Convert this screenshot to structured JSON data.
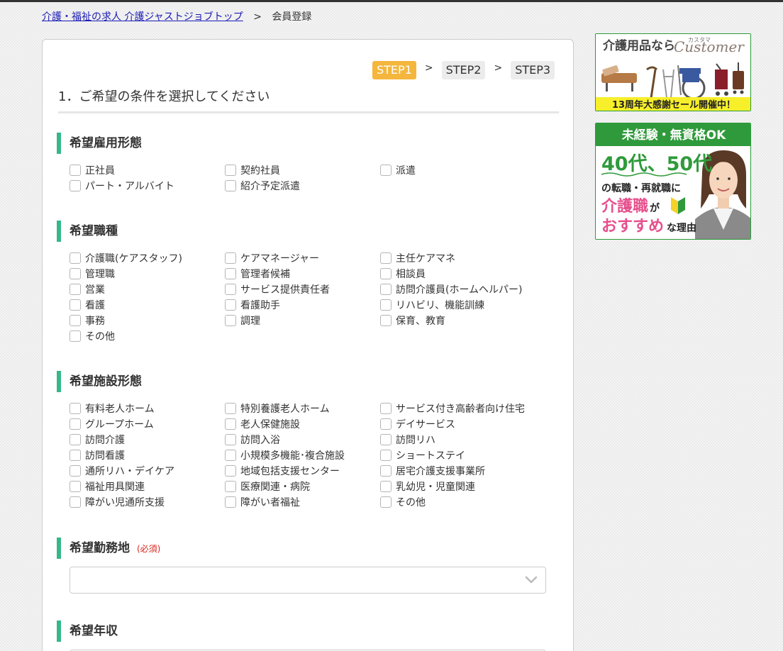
{
  "breadcrumb": {
    "home": "介護・福祉の求人 介護ジャストジョブトップ",
    "separator": ">",
    "current": "会員登録"
  },
  "steps": [
    {
      "label": "STEP1",
      "active": true
    },
    {
      "label": "STEP2",
      "active": false
    },
    {
      "label": "STEP3",
      "active": false
    }
  ],
  "step_separator": ">",
  "page_title": "1．ご希望の条件を選択してください",
  "sections": {
    "employment": {
      "title": "希望雇用形態",
      "options": [
        "正社員",
        "契約社員",
        "派遣",
        "パート・アルバイト",
        "紹介予定派遣"
      ]
    },
    "job_type": {
      "title": "希望職種",
      "options": [
        "介護職(ケアスタッフ)",
        "ケアマネージャー",
        "主任ケアマネ",
        "管理職",
        "管理者候補",
        "相談員",
        "営業",
        "サービス提供責任者",
        "訪問介護員(ホームヘルパー)",
        "看護",
        "看護助手",
        "リハビリ、機能訓練",
        "事務",
        "調理",
        "保育、教育",
        "その他"
      ]
    },
    "facility": {
      "title": "希望施設形態",
      "options": [
        "有料老人ホーム",
        "特別養護老人ホーム",
        "サービス付き高齢者向け住宅",
        "グループホーム",
        "老人保健施設",
        "デイサービス",
        "訪問介護",
        "訪問入浴",
        "訪問リハ",
        "訪問看護",
        "小規模多機能･複合施設",
        "ショートステイ",
        "通所リハ・デイケア",
        "地域包括支援センター",
        "居宅介護支援事業所",
        "福祉用具関連",
        "医療関連・病院",
        "乳幼児・児童関連",
        "障がい児通所支援",
        "障がい者福祉",
        "その他"
      ]
    },
    "location": {
      "title": "希望勤務地",
      "required": "(必須)",
      "value": ""
    },
    "income": {
      "title": "希望年収"
    }
  },
  "banners": {
    "customer": {
      "headline": "介護用品なら",
      "kana": "カスタマ",
      "brand": "Customer",
      "footer": "13周年大感謝セール開催中！"
    },
    "career": {
      "top": "未経験・無資格OK",
      "line1": "40代、50代",
      "line2": "の転職・再就職に",
      "line3a": "介護職",
      "line3b": "が",
      "line4a": "おすすめ",
      "line4b": "な理由"
    }
  },
  "colors": {
    "accent_green": "#35b887",
    "step_active": "#f4b63c",
    "required_red": "#d9261c",
    "link_blue": "#1b1bb5"
  }
}
